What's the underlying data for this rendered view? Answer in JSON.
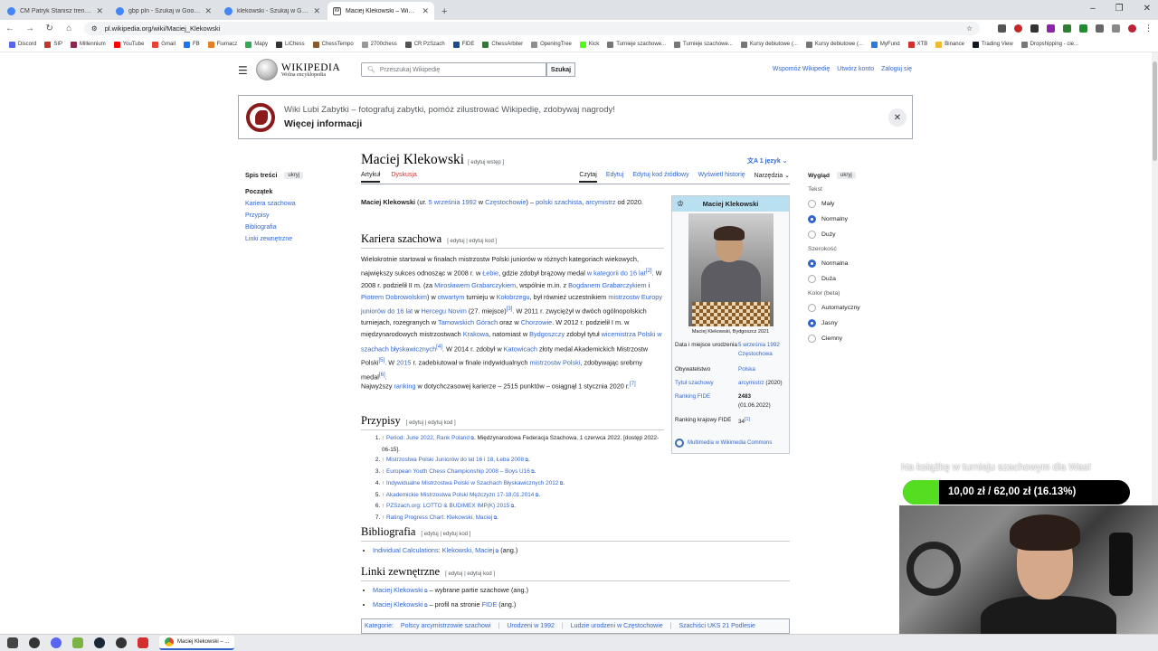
{
  "browser": {
    "tabs": [
      {
        "title": "CM Patryk Stanisz trenuje uczn",
        "color": "#4285f4"
      },
      {
        "title": "gbp pln - Szukaj w Google",
        "color": "#4285f4"
      },
      {
        "title": "klekowski - Szukaj w Google",
        "color": "#4285f4"
      },
      {
        "title": "Maciej Klekowski – Wikipedia, w",
        "color": "#555555"
      }
    ],
    "new_tab": "+",
    "url": "pl.wikipedia.org/wiki/Maciej_Klekowski",
    "bookmarks": [
      {
        "label": "Discord",
        "color": "#5865f2"
      },
      {
        "label": "SIP",
        "color": "#c0392b"
      },
      {
        "label": "Millennium",
        "color": "#8e2450"
      },
      {
        "label": "YouTube",
        "color": "#ff0000"
      },
      {
        "label": "Gmail",
        "color": "#ea4335"
      },
      {
        "label": "FB",
        "color": "#1877f2"
      },
      {
        "label": "Fiumacz",
        "color": "#e67e22"
      },
      {
        "label": "Mapy",
        "color": "#34a853"
      },
      {
        "label": "LiChess",
        "color": "#333333"
      },
      {
        "label": "ChessTempo",
        "color": "#8b5a2b"
      },
      {
        "label": "2700chess",
        "color": "#999999"
      },
      {
        "label": "CR PzSzach",
        "color": "#555555"
      },
      {
        "label": "FIDE",
        "color": "#1a4d8f"
      },
      {
        "label": "ChessArbiter",
        "color": "#2e7d32"
      },
      {
        "label": "OpeningTree",
        "color": "#8e8e8e"
      },
      {
        "label": "Kick",
        "color": "#53fc18"
      },
      {
        "label": "Turnieje szachowe...",
        "color": "#777777"
      },
      {
        "label": "Turnieje szachowe...",
        "color": "#777777"
      },
      {
        "label": "Kursy debiutowe (...",
        "color": "#777777"
      },
      {
        "label": "Kursy debiutowe (...",
        "color": "#777777"
      },
      {
        "label": "MyFund",
        "color": "#2a7ae2"
      },
      {
        "label": "XTB",
        "color": "#d32f2f"
      },
      {
        "label": "Binance",
        "color": "#f3ba2f"
      },
      {
        "label": "Trading View",
        "color": "#131722"
      },
      {
        "label": "Dropshipping - cie...",
        "color": "#777777"
      }
    ]
  },
  "wiki": {
    "logo_title": "WIKIPEDIA",
    "logo_subtitle": "Wolna encyklopedia",
    "search_placeholder": "Przeszukaj Wikipedię",
    "search_button": "Szukaj",
    "user_links": [
      "Wspomóż Wikipedię",
      "Utwórz konto",
      "Zaloguj się"
    ],
    "banner": {
      "text": "Wiki Lubi Zabytki – fotografuj zabytki, pomóż zilustrować Wikipedię, zdobywaj nagrody!",
      "link": "Więcej informacji",
      "close": "✕"
    },
    "toc": {
      "title": "Spis treści",
      "hide": "ukryj",
      "items": [
        "Początek",
        "Kariera szachowa",
        "Przypisy",
        "Bibliografia",
        "Linki zewnętrzne"
      ]
    },
    "page_title": "Maciej Klekowski",
    "edit_intro": "[ edytuj wstęp ]",
    "languages": "1 język",
    "tabs_left": [
      "Artykuł",
      "Dyskusja"
    ],
    "tabs_right": [
      "Czytaj",
      "Edytuj",
      "Edytuj kod źródłowy",
      "Wyświetl historię",
      "Narzędzia"
    ],
    "intro": {
      "name": "Maciej Klekowski",
      "p1": " (ur. ",
      "date": "5 września 1992",
      "p2": " w ",
      "city": "Częstochowie",
      "p3": ") – ",
      "nat": "polski szachista",
      "p4": ", ",
      "title": "arcymistrz",
      "p5": " od 2020."
    },
    "sections": {
      "career": "Kariera szachowa",
      "refs": "Przypisy",
      "bib": "Bibliografia",
      "ext": "Linki zewnętrzne",
      "edit": "[ edytuj | edytuj kod ]"
    },
    "career_text": {
      "s1": "Wielokrotnie startował w finałach mistrzostw Polski juniorów w różnych kategoriach wiekowych, największy sukces odnosząc w 2008 r. w ",
      "l1": "Łebie",
      "s2": ", gdzie zdobył brązowy medal ",
      "l2": "w kategorii do 16 lat",
      "r2": "[2]",
      "s3": ". W 2008 r. podzielił II m. (za ",
      "l3": "Mirosławem Grabarczykiem",
      "s4": ", wspólnie m.in. z ",
      "l4": "Bogdanem Grabarczykiem",
      "s5": " i ",
      "l5": "Piotrem Dobrowolskim",
      "s6": ") w ",
      "l6": "otwartym",
      "s7": " turnieju w ",
      "l7": "Kołobrzegu",
      "s8": ", był również uczestnikiem ",
      "l8": "mistrzostw Europy juniorów do 16 lat",
      "s9": " w ",
      "l9": "Hercegu Novim",
      "s10": " (27. miejsce)",
      "r3": "[3]",
      "s11": ". W 2011 r. zwyciężył w dwóch ogólnopolskich turniejach, rozegranych w ",
      "l10": "Tarnowskich Górach",
      "s12": " oraz w ",
      "l11": "Chorzowie",
      "s13": ". W 2012 r. podzielił I m. w międzynarodowych mistrzostwach ",
      "l12": "Krakowa",
      "s14": ", natomiast w ",
      "l13": "Bydgoszczy",
      "s15": " zdobył tytuł ",
      "l14": "wicemistrza Polski w szachach błyskawicznych",
      "r4": "[4]",
      "s16": ". W 2014 r. zdobył w ",
      "l15": "Katowicach",
      "s17": " złoty medal Akademickich Mistrzostw Polski",
      "r5": "[5]",
      "s18": ". W ",
      "l16": "2015",
      "s19": " r. zadebiutował w finale indywidualnych ",
      "l17": "mistrzostw Polski",
      "s20": ", zdobywając srebrny medal",
      "r6": "[6]",
      "s21": "."
    },
    "ranking_text": {
      "s1": "Najwyższy ",
      "l1": "ranking",
      "s2": " w dotychczasowej karierze – 2515 punktów – osiągnął 1 stycznia 2020 r.",
      "r7": "[7]"
    },
    "references": [
      {
        "link": "↑ Period: June 2022, Rank Poland",
        "rest": ". Międzynarodowa Federacja Szachowa, 1 czerwca 2022. [dostęp 2022-06-15]."
      },
      {
        "link": "↑ Mistrzostwa Polski Juniorów do lat 16 i 18, Łeba 2008",
        "rest": "."
      },
      {
        "link": "↑ European Youth Chess Championship 2008 – Boys U16",
        "rest": "."
      },
      {
        "link": "↑ Indywidualne Mistrzostwa Polski w Szachach Błyskawicznych 2012",
        "rest": "."
      },
      {
        "link": "↑ Akademickie Mistrzostwa Polski Mężczyzn 17-18.01.2014",
        "rest": "."
      },
      {
        "link": "↑ PZSzach.org: LOTTO & BUDIMEX IMP(K) 2015",
        "rest": "."
      },
      {
        "link": "↑ Rating Progress Chart: Klekowski, Maciej",
        "rest": "."
      }
    ],
    "bibliography": [
      {
        "link": "Individual Calculations: Klekowski, Maciej",
        "rest": " (ang.)"
      }
    ],
    "external_links": [
      {
        "link": "Maciej Klekowski",
        "rest": " – wybrane partie szachowe (ang.)"
      },
      {
        "link": "Maciej Klekowski",
        "rest": " – profil na stronie ",
        "link2": "FIDE",
        "rest2": " (ang.)"
      }
    ],
    "categories_label": "Kategorie:",
    "categories": [
      "Polscy arcymistrzowie szachowi",
      "Urodzeni w 1992",
      "Ludzie urodzeni w Częstochowie",
      "Szachiści UKS 21 Podlesie"
    ],
    "infobox": {
      "title": "Maciej Klekowski",
      "symbol": "♔",
      "caption": "Maciej Klekowski, Bydgoszcz 2021",
      "rows": {
        "birth_k": "Data i miejsce urodzenia",
        "birth_v1": "5 września 1992",
        "birth_v2": "Częstochowa",
        "citizen_k": "Obywatelstwo",
        "citizen_v": "Polska",
        "title_k": "Tytuł szachowy",
        "title_v": "arcymistrz",
        "title_y": " (2020)",
        "fide_k": "Ranking FIDE",
        "fide_v": "2483",
        "fide_d": "(01.06.2022)",
        "nat_k": "Ranking krajowy FIDE",
        "nat_v": "34",
        "nat_r": "[1]"
      },
      "commons": "Multimedia w Wikimedia Commons"
    },
    "appearance": {
      "title": "Wygląd",
      "hide": "ukryj",
      "text_label": "Tekst",
      "text_options": [
        "Mały",
        "Normalny",
        "Duży"
      ],
      "width_label": "Szerokość",
      "width_options": [
        "Normalna",
        "Duża"
      ],
      "color_label": "Kolor (beta)",
      "color_options": [
        "Automatyczny",
        "Jasny",
        "Ciemny"
      ]
    }
  },
  "overlay": {
    "donate_text": "Na książkę w turnieju szachowym dla Was!",
    "donate_amount": "10,00 zł / 62,00 zł (16.13%)",
    "donate_fraction": 0.1613,
    "donate_color": "#55dd22"
  },
  "taskbar": {
    "active_label": "Maciej Klekowski – ..."
  }
}
